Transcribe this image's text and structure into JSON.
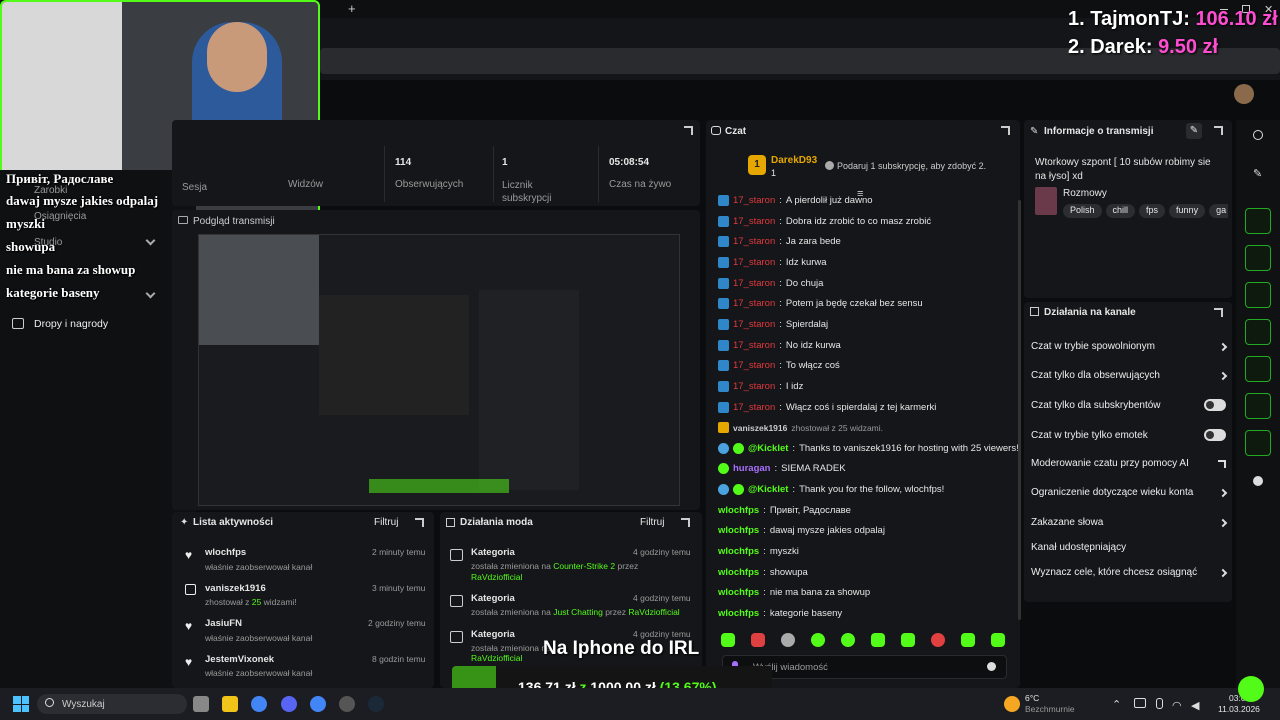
{
  "browser": {
    "tab_plus": "+",
    "tab_close": "×"
  },
  "leaderboard": {
    "first": {
      "rank_name": "1. TajmonTJ:",
      "amount": "106.10 zł"
    },
    "second": {
      "rank_name": "2. Darek:",
      "amount": "9.50 zł"
    }
  },
  "stats": [
    {
      "value": "114",
      "label": "Obserwujących"
    },
    {
      "value": "1",
      "label": "Licznik subskrypcji"
    },
    {
      "value": "05:08:54",
      "label": "Czas na żywo"
    }
  ],
  "left_nav": {
    "items": [
      "Zarobki",
      "Osiągnięcia",
      "Studio",
      "Dropy i nagrody"
    ],
    "session_label": "Sesja",
    "viewers_label": "Widzów",
    "preview_label": "Podgląd transmisji"
  },
  "overlay_chat": [
    "Привіт, Радославе",
    "dawaj mysze jakies odpalaj",
    "myszki",
    "showupa",
    "nie ma bana za showup",
    "kategorie baseny"
  ],
  "chat": {
    "title": "Czat",
    "pinned_user": "DarekD93",
    "pinned_sub": "1",
    "pinned_rank": "1",
    "sub_prompt": "Podaruj 1 subskrypcję, aby zdobyć 2.",
    "messages": [
      {
        "user": "17_staron",
        "text": "A pierdolił już dawno",
        "color": "red"
      },
      {
        "user": "17_staron",
        "text": "Dobra idz zrobić to co masz zrobić",
        "color": "red"
      },
      {
        "user": "17_staron",
        "text": "Ja zara bede",
        "color": "red"
      },
      {
        "user": "17_staron",
        "text": "Idz kurwa",
        "color": "red"
      },
      {
        "user": "17_staron",
        "text": "Do chuja",
        "color": "red"
      },
      {
        "user": "17_staron",
        "text": "Potem ja będę czekał bez sensu",
        "color": "red"
      },
      {
        "user": "17_staron",
        "text": "Spierdalaj",
        "color": "red"
      },
      {
        "user": "17_staron",
        "text": "No idz kurwa",
        "color": "red"
      },
      {
        "user": "17_staron",
        "text": "To włącz coś",
        "color": "red"
      },
      {
        "user": "17_staron",
        "text": "I idz",
        "color": "red"
      },
      {
        "user": "17_staron",
        "text": "Włącz coś i spierdalaj z tej karmerki",
        "color": "red"
      }
    ],
    "host_notice": {
      "user": "vaniszek1916",
      "text": "zhostował z 25 widzami."
    },
    "messages2": [
      {
        "user": "@Kicklet",
        "text": "Thanks to vaniszek1916 for hosting with 25 viewers!",
        "color": "green"
      },
      {
        "user": "huragan",
        "text": "SIEMA RADEK",
        "color": "purple"
      },
      {
        "user": "@Kicklet",
        "text": "Thank you for the follow, wlochfps!",
        "color": "green"
      },
      {
        "user": "wlochfps",
        "text": "Привіт, Радославе",
        "color": "green"
      },
      {
        "user": "wlochfps",
        "text": "dawaj mysze jakies odpalaj",
        "color": "green"
      },
      {
        "user": "wlochfps",
        "text": "myszki",
        "color": "green"
      },
      {
        "user": "wlochfps",
        "text": "showupa",
        "color": "green"
      },
      {
        "user": "wlochfps",
        "text": "nie ma bana za showup",
        "color": "green"
      },
      {
        "user": "wlochfps",
        "text": "kategorie baseny",
        "color": "green"
      }
    ],
    "input_placeholder": "Wyślij wiadomość"
  },
  "stream_info": {
    "title": "Informacje o transmisji",
    "stream_title": "Wtorkowy szpont [ 10 subów robimy sie na łyso] xd",
    "category": "Rozmowy",
    "tags": [
      "Polish",
      "chill",
      "fps",
      "funny",
      "ga"
    ]
  },
  "channel_actions": {
    "title": "Działania na kanale",
    "items": [
      {
        "label": "Czat w trybie spowolnionym",
        "control": "chevron"
      },
      {
        "label": "Czat tylko dla obserwujących",
        "control": "chevron"
      },
      {
        "label": "Czat tylko dla subskrybentów",
        "control": "toggle"
      },
      {
        "label": "Czat w trybie tylko emotek",
        "control": "toggle"
      },
      {
        "label": "Moderowanie czatu przy pomocy AI",
        "control": "external"
      },
      {
        "label": "Ograniczenie dotyczące wieku konta",
        "control": "chevron"
      },
      {
        "label": "Zakazane słowa",
        "control": "chevron"
      },
      {
        "label": "Kanał udostępniający",
        "control": "none"
      },
      {
        "label": "Wyznacz cele, które chcesz osiągnąć",
        "control": "chevron"
      }
    ]
  },
  "activity": {
    "title": "Lista aktywności",
    "filter": "Filtruj",
    "items": [
      {
        "name": "wlochfps",
        "desc": "właśnie zaobserwował kanał",
        "time": "2 minuty temu",
        "icon": "heart-icon"
      },
      {
        "name": "vaniszek1916",
        "desc_pre": "zhostował z ",
        "desc_num": "25",
        "desc_post": " widzami!",
        "time": "3 minuty temu",
        "icon": "host-icon"
      },
      {
        "name": "JasiuFN",
        "desc": "właśnie zaobserwował kanał",
        "time": "2 godziny temu",
        "icon": "heart-icon"
      },
      {
        "name": "JestemVixonek",
        "desc": "właśnie zaobserwował kanał",
        "time": "8 godzin temu",
        "icon": "heart-icon"
      }
    ]
  },
  "mod": {
    "title": "Działania moda",
    "filter": "Filtruj",
    "items": [
      {
        "name": "Kategoria",
        "pre": "została zmieniona na ",
        "cat": "Counter-Strike 2",
        "mid": " przez ",
        "who": "RaVdziofficial",
        "time": "4 godziny temu"
      },
      {
        "name": "Kategoria",
        "pre": "została zmieniona na ",
        "cat": "Just Chatting",
        "mid": " przez ",
        "who": "RaVdziofficial",
        "time": "4 godziny temu"
      },
      {
        "name": "Kategoria",
        "pre": "została zmieniona na ",
        "cat": "",
        "mid": "",
        "who": "RaVdziofficial",
        "time": "4 godziny temu"
      }
    ]
  },
  "goal": {
    "title": "Na Iphone do IRL",
    "current": "136,71 zł",
    "sep": "z",
    "target": "1000,00 zł",
    "pct": "(13.67%)",
    "progress": 0.1367
  },
  "taskbar": {
    "search": "Wyszukaj",
    "weather_temp": "6°C",
    "weather_desc": "Bezchmurnie",
    "time": "03:05",
    "date": "11.03.2026"
  },
  "colors": {
    "accent": "#53fc18",
    "red": "#e0393e",
    "purple": "#a970ff"
  }
}
